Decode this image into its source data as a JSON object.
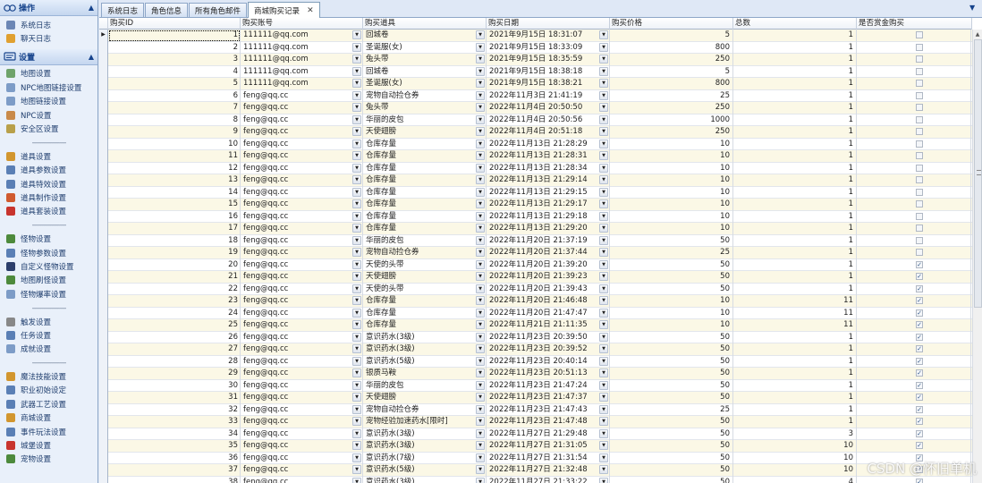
{
  "sidebar": {
    "operations": {
      "title": "操作",
      "items": [
        {
          "label": "系统日志",
          "icon": "log-icon",
          "color": "#6b86b5"
        },
        {
          "label": "聊天日志",
          "icon": "chat-icon",
          "color": "#e0a030"
        }
      ]
    },
    "settings": {
      "title": "设置",
      "items": [
        {
          "label": "地图设置",
          "icon": "map-icon",
          "color": "#6fa36b"
        },
        {
          "label": "NPC地图链接设置",
          "icon": "map-link-icon",
          "color": "#7d9cc7"
        },
        {
          "label": "地图链接设置",
          "icon": "link-icon",
          "color": "#7d9cc7"
        },
        {
          "label": "NPC设置",
          "icon": "npc-icon",
          "color": "#c98a4a"
        },
        {
          "label": "安全区设置",
          "icon": "safe-zone-icon",
          "color": "#b8a04a"
        },
        {
          "sep": "--------------------"
        },
        {
          "label": "道具设置",
          "icon": "item-icon",
          "color": "#d2962f"
        },
        {
          "label": "道具参数设置",
          "icon": "item-param-icon",
          "color": "#5a7fb5"
        },
        {
          "label": "道具特效设置",
          "icon": "item-effect-icon",
          "color": "#5a7fb5"
        },
        {
          "label": "道具制作设置",
          "icon": "item-craft-icon",
          "color": "#d05a2f"
        },
        {
          "label": "道具套装设置",
          "icon": "item-set-icon",
          "color": "#c8342e"
        },
        {
          "sep": "--------------------"
        },
        {
          "label": "怪物设置",
          "icon": "monster-icon",
          "color": "#4d8a3c"
        },
        {
          "label": "怪物参数设置",
          "icon": "monster-param-icon",
          "color": "#5a7fb5"
        },
        {
          "label": "自定义怪物设置",
          "icon": "custom-monster-icon",
          "color": "#2c3e6b"
        },
        {
          "label": "地图刷怪设置",
          "icon": "spawn-icon",
          "color": "#4d8a3c"
        },
        {
          "label": "怪物爆率设置",
          "icon": "drop-rate-icon",
          "color": "#7d9cc7"
        },
        {
          "sep": "--------------------"
        },
        {
          "label": "触发设置",
          "icon": "trigger-icon",
          "color": "#888888"
        },
        {
          "label": "任务设置",
          "icon": "quest-icon",
          "color": "#5a7fb5"
        },
        {
          "label": "成就设置",
          "icon": "achievement-icon",
          "color": "#7d9cc7"
        },
        {
          "sep": "--------------------"
        },
        {
          "label": "魔法技能设置",
          "icon": "magic-icon",
          "color": "#d2962f"
        },
        {
          "label": "职业初始设定",
          "icon": "class-icon",
          "color": "#5a7fb5"
        },
        {
          "label": "武器工艺设置",
          "icon": "weapon-icon",
          "color": "#5a7fb5"
        },
        {
          "label": "商城设置",
          "icon": "shop-icon",
          "color": "#d2962f"
        },
        {
          "label": "事件玩法设置",
          "icon": "event-icon",
          "color": "#5a7fb5"
        },
        {
          "label": "城堡设置",
          "icon": "castle-icon",
          "color": "#c8342e"
        },
        {
          "label": "宠物设置",
          "icon": "pet-icon",
          "color": "#4d8a3c"
        }
      ]
    }
  },
  "tabs": [
    {
      "label": "系统日志",
      "active": false
    },
    {
      "label": "角色信息",
      "active": false
    },
    {
      "label": "所有角色邮件",
      "active": false
    },
    {
      "label": "商城购买记录",
      "active": true
    }
  ],
  "grid": {
    "columns": {
      "id": "购买ID",
      "account": "购买账号",
      "item": "购买道具",
      "date": "购买日期",
      "price": "购买价格",
      "total": "总数",
      "gold": "是否赏金购买"
    },
    "rows": [
      {
        "id": "1",
        "account": "111111@qq.com",
        "item": "回城卷",
        "date": "2021年9月15日 18:31:07",
        "price": "5",
        "total": "1",
        "gold": false
      },
      {
        "id": "2",
        "account": "111111@qq.com",
        "item": "圣诞服(女)",
        "date": "2021年9月15日 18:33:09",
        "price": "800",
        "total": "1",
        "gold": false
      },
      {
        "id": "3",
        "account": "111111@qq.com",
        "item": "兔头带",
        "date": "2021年9月15日 18:35:59",
        "price": "250",
        "total": "1",
        "gold": false
      },
      {
        "id": "4",
        "account": "111111@qq.com",
        "item": "回城卷",
        "date": "2021年9月15日 18:38:18",
        "price": "5",
        "total": "1",
        "gold": false
      },
      {
        "id": "5",
        "account": "111111@qq.com",
        "item": "圣诞服(女)",
        "date": "2021年9月15日 18:38:21",
        "price": "800",
        "total": "1",
        "gold": false
      },
      {
        "id": "6",
        "account": "feng@qq.cc",
        "item": "宠物自动捡仓券",
        "date": "2022年11月3日 21:41:19",
        "price": "25",
        "total": "1",
        "gold": false
      },
      {
        "id": "7",
        "account": "feng@qq.cc",
        "item": "兔头带",
        "date": "2022年11月4日 20:50:50",
        "price": "250",
        "total": "1",
        "gold": false
      },
      {
        "id": "8",
        "account": "feng@qq.cc",
        "item": "华丽的皮包",
        "date": "2022年11月4日 20:50:56",
        "price": "1000",
        "total": "1",
        "gold": false
      },
      {
        "id": "9",
        "account": "feng@qq.cc",
        "item": "天使翅膀",
        "date": "2022年11月4日 20:51:18",
        "price": "250",
        "total": "1",
        "gold": false
      },
      {
        "id": "10",
        "account": "feng@qq.cc",
        "item": "仓库存量",
        "date": "2022年11月13日 21:28:29",
        "price": "10",
        "total": "1",
        "gold": false
      },
      {
        "id": "11",
        "account": "feng@qq.cc",
        "item": "仓库存量",
        "date": "2022年11月13日 21:28:31",
        "price": "10",
        "total": "1",
        "gold": false
      },
      {
        "id": "12",
        "account": "feng@qq.cc",
        "item": "仓库存量",
        "date": "2022年11月13日 21:28:34",
        "price": "10",
        "total": "1",
        "gold": false
      },
      {
        "id": "13",
        "account": "feng@qq.cc",
        "item": "仓库存量",
        "date": "2022年11月13日 21:29:14",
        "price": "10",
        "total": "1",
        "gold": false
      },
      {
        "id": "14",
        "account": "feng@qq.cc",
        "item": "仓库存量",
        "date": "2022年11月13日 21:29:15",
        "price": "10",
        "total": "1",
        "gold": false
      },
      {
        "id": "15",
        "account": "feng@qq.cc",
        "item": "仓库存量",
        "date": "2022年11月13日 21:29:17",
        "price": "10",
        "total": "1",
        "gold": false
      },
      {
        "id": "16",
        "account": "feng@qq.cc",
        "item": "仓库存量",
        "date": "2022年11月13日 21:29:18",
        "price": "10",
        "total": "1",
        "gold": false
      },
      {
        "id": "17",
        "account": "feng@qq.cc",
        "item": "仓库存量",
        "date": "2022年11月13日 21:29:20",
        "price": "10",
        "total": "1",
        "gold": false
      },
      {
        "id": "18",
        "account": "feng@qq.cc",
        "item": "华丽的皮包",
        "date": "2022年11月20日 21:37:19",
        "price": "50",
        "total": "1",
        "gold": false
      },
      {
        "id": "19",
        "account": "feng@qq.cc",
        "item": "宠物自动捡仓券",
        "date": "2022年11月20日 21:37:44",
        "price": "25",
        "total": "1",
        "gold": false
      },
      {
        "id": "20",
        "account": "feng@qq.cc",
        "item": "天使的头带",
        "date": "2022年11月20日 21:39:20",
        "price": "50",
        "total": "1",
        "gold": true
      },
      {
        "id": "21",
        "account": "feng@qq.cc",
        "item": "天使翅膀",
        "date": "2022年11月20日 21:39:23",
        "price": "50",
        "total": "1",
        "gold": true
      },
      {
        "id": "22",
        "account": "feng@qq.cc",
        "item": "天使的头带",
        "date": "2022年11月20日 21:39:43",
        "price": "50",
        "total": "1",
        "gold": true
      },
      {
        "id": "23",
        "account": "feng@qq.cc",
        "item": "仓库存量",
        "date": "2022年11月20日 21:46:48",
        "price": "10",
        "total": "11",
        "gold": true
      },
      {
        "id": "24",
        "account": "feng@qq.cc",
        "item": "仓库存量",
        "date": "2022年11月20日 21:47:47",
        "price": "10",
        "total": "11",
        "gold": true
      },
      {
        "id": "25",
        "account": "feng@qq.cc",
        "item": "仓库存量",
        "date": "2022年11月21日 21:11:35",
        "price": "10",
        "total": "11",
        "gold": true
      },
      {
        "id": "26",
        "account": "feng@qq.cc",
        "item": "意识药水(3级)",
        "date": "2022年11月23日 20:39:50",
        "price": "50",
        "total": "1",
        "gold": true
      },
      {
        "id": "27",
        "account": "feng@qq.cc",
        "item": "意识药水(3级)",
        "date": "2022年11月23日 20:39:52",
        "price": "50",
        "total": "1",
        "gold": true
      },
      {
        "id": "28",
        "account": "feng@qq.cc",
        "item": "意识药水(5级)",
        "date": "2022年11月23日 20:40:14",
        "price": "50",
        "total": "1",
        "gold": true
      },
      {
        "id": "29",
        "account": "feng@qq.cc",
        "item": "银质马鞍",
        "date": "2022年11月23日 20:51:13",
        "price": "50",
        "total": "1",
        "gold": true
      },
      {
        "id": "30",
        "account": "feng@qq.cc",
        "item": "华丽的皮包",
        "date": "2022年11月23日 21:47:24",
        "price": "50",
        "total": "1",
        "gold": true
      },
      {
        "id": "31",
        "account": "feng@qq.cc",
        "item": "天使翅膀",
        "date": "2022年11月23日 21:47:37",
        "price": "50",
        "total": "1",
        "gold": true
      },
      {
        "id": "32",
        "account": "feng@qq.cc",
        "item": "宠物自动捡仓券",
        "date": "2022年11月23日 21:47:43",
        "price": "25",
        "total": "1",
        "gold": true
      },
      {
        "id": "33",
        "account": "feng@qq.cc",
        "item": "宠物经验加速药水[限时]",
        "date": "2022年11月23日 21:47:48",
        "price": "50",
        "total": "1",
        "gold": true
      },
      {
        "id": "34",
        "account": "feng@qq.cc",
        "item": "意识药水(3级)",
        "date": "2022年11月27日 21:29:48",
        "price": "50",
        "total": "3",
        "gold": true
      },
      {
        "id": "35",
        "account": "feng@qq.cc",
        "item": "意识药水(3级)",
        "date": "2022年11月27日 21:31:05",
        "price": "50",
        "total": "10",
        "gold": true
      },
      {
        "id": "36",
        "account": "feng@qq.cc",
        "item": "意识药水(7级)",
        "date": "2022年11月27日 21:31:54",
        "price": "50",
        "total": "10",
        "gold": true
      },
      {
        "id": "37",
        "account": "feng@qq.cc",
        "item": "意识药水(5级)",
        "date": "2022年11月27日 21:32:48",
        "price": "50",
        "total": "10",
        "gold": true
      },
      {
        "id": "38",
        "account": "feng@qq.cc",
        "item": "意识药水(3级)",
        "date": "2022年11月27日 21:33:22",
        "price": "50",
        "total": "4",
        "gold": true
      }
    ]
  },
  "watermark": "CSDN @怀旧单机"
}
